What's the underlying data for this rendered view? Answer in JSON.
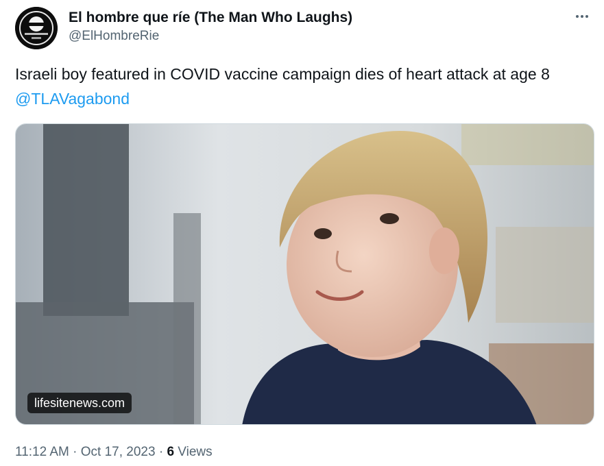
{
  "author": {
    "display_name": "El hombre que ríe (The Man Who Laughs)",
    "handle": "@ElHombreRie"
  },
  "tweet": {
    "text": "Israeli boy featured in COVID vaccine campaign dies of heart attack at age 8 ",
    "mention": "@TLAVagabond"
  },
  "media": {
    "source_label": "lifesitenews.com"
  },
  "meta": {
    "time": "11:12 AM",
    "separator": " · ",
    "date": "Oct 17, 2023",
    "views_count": "6",
    "views_label": " Views"
  },
  "colors": {
    "link": "#1d9bf0",
    "secondary_text": "#536471",
    "primary_text": "#0f1419"
  },
  "icons": {
    "more": "more-options-icon"
  }
}
